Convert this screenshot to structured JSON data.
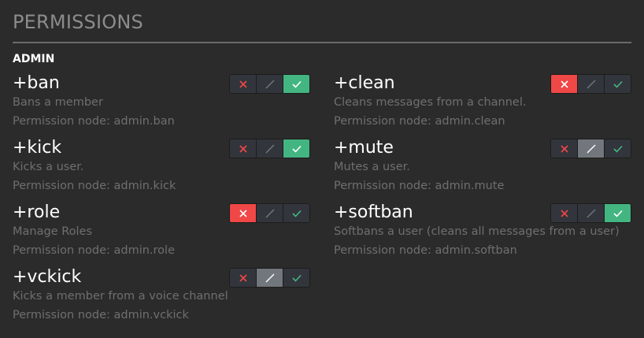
{
  "header": {
    "title": "PERMISSIONS"
  },
  "section": {
    "label": "ADMIN"
  },
  "colors": {
    "deny": "#f04747",
    "neutral": "#72767d",
    "allow": "#43b581",
    "background": "#2b2b2b"
  },
  "permissions": [
    {
      "name": "+ban",
      "description": "Bans a member",
      "node_prefix": "Permission node: ",
      "node": "admin.ban",
      "state": "allow"
    },
    {
      "name": "+clean",
      "description": "Cleans messages from a channel.",
      "node_prefix": "Permission node: ",
      "node": "admin.clean",
      "state": "deny"
    },
    {
      "name": "+kick",
      "description": "Kicks a user.",
      "node_prefix": "Permission node: ",
      "node": "admin.kick",
      "state": "allow"
    },
    {
      "name": "+mute",
      "description": "Mutes a user.",
      "node_prefix": "Permission node: ",
      "node": "admin.mute",
      "state": "neutral"
    },
    {
      "name": "+role",
      "description": "Manage Roles",
      "node_prefix": "Permission node: ",
      "node": "admin.role",
      "state": "deny"
    },
    {
      "name": "+softban",
      "description": "Softbans a user (cleans all messages from a user)",
      "node_prefix": "Permission node: ",
      "node": "admin.softban",
      "state": "allow"
    },
    {
      "name": "+vckick",
      "description": "Kicks a member from a voice channel",
      "node_prefix": "Permission node: ",
      "node": "admin.vckick",
      "state": "neutral"
    }
  ]
}
